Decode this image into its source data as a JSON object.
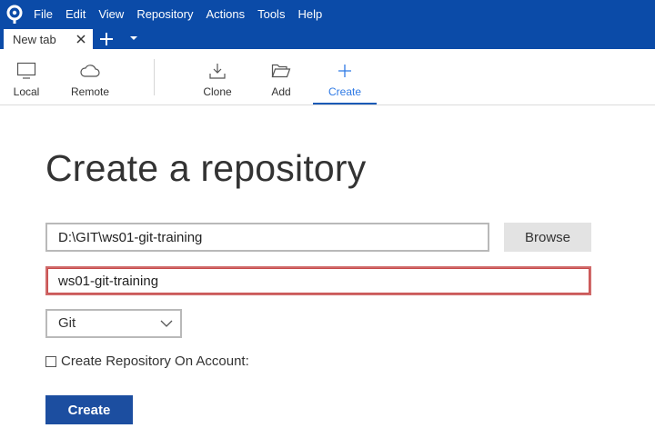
{
  "menu": {
    "items": [
      "File",
      "Edit",
      "View",
      "Repository",
      "Actions",
      "Tools",
      "Help"
    ]
  },
  "tabs": {
    "active_label": "New tab"
  },
  "toolbar": {
    "local": "Local",
    "remote": "Remote",
    "clone": "Clone",
    "add": "Add",
    "create": "Create"
  },
  "form": {
    "title": "Create a repository",
    "path_value": "D:\\GIT\\ws01-git-training",
    "browse_label": "Browse",
    "name_value": "ws01-git-training",
    "repo_type": "Git",
    "account_checkbox_label": "Create Repository On Account:",
    "account_checked": false,
    "submit_label": "Create"
  },
  "colors": {
    "brand_blue": "#0b4ba8",
    "active_blue": "#2f7ae5",
    "button_blue": "#1c4ea0",
    "error_red": "#c84a4a"
  }
}
